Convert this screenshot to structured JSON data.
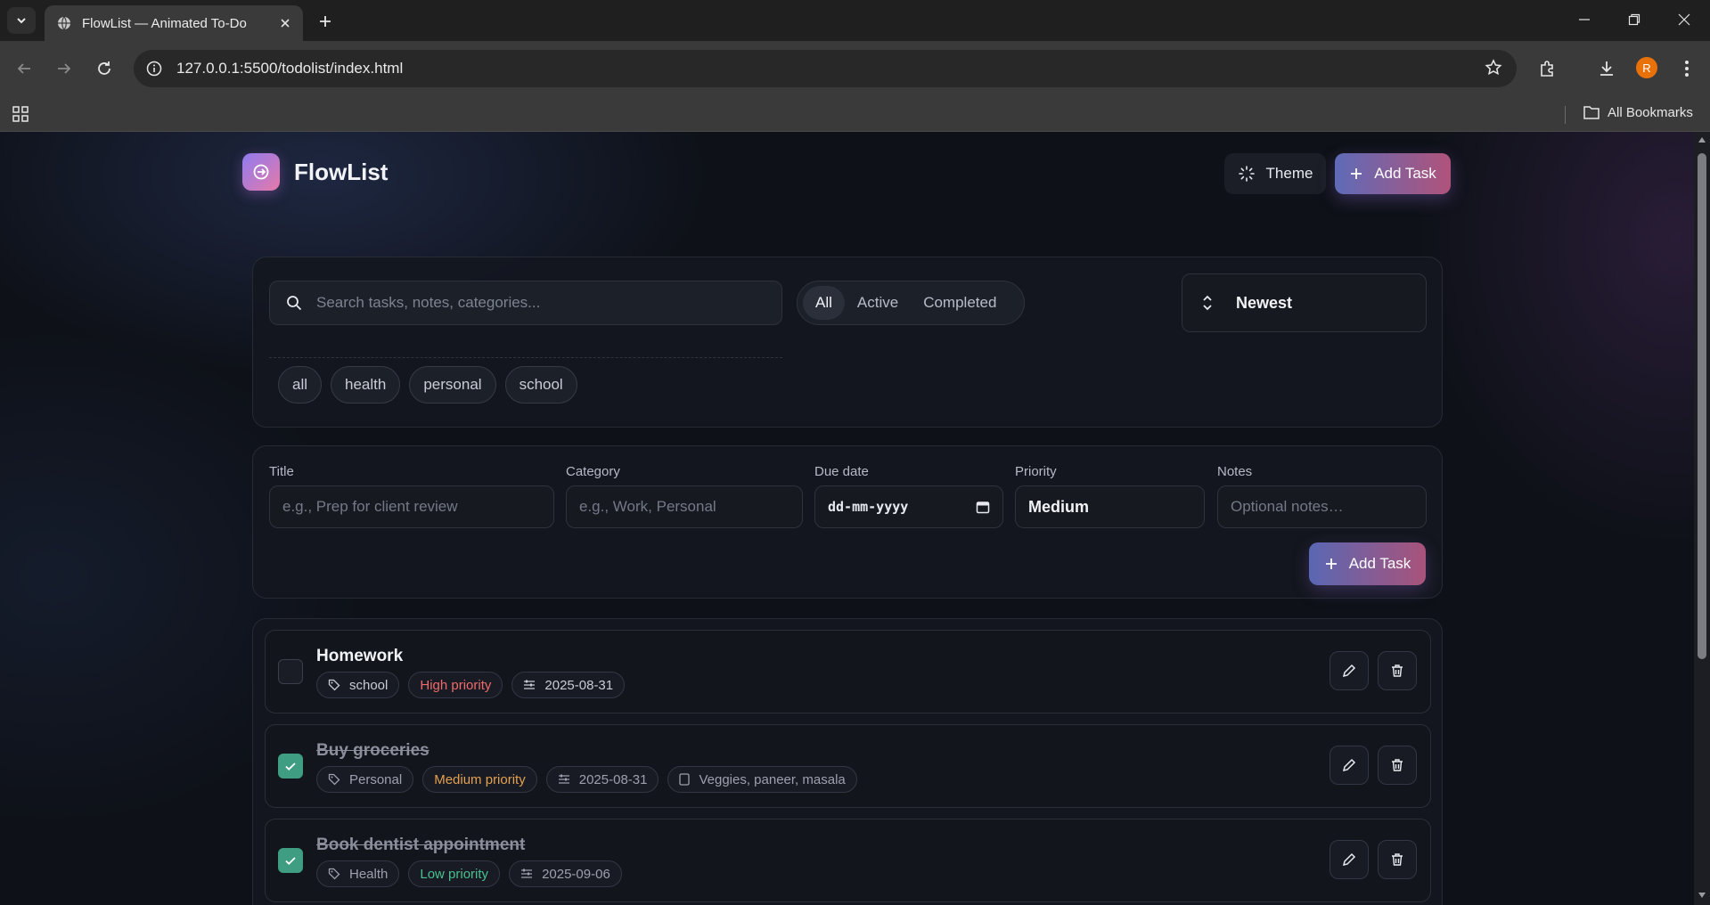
{
  "browser": {
    "tab_title": "FlowList — Animated To-Do",
    "url": "127.0.0.1:5500/todolist/index.html",
    "bookmarks_label": "All Bookmarks",
    "profile_initial": "R"
  },
  "header": {
    "brand": "FlowList",
    "theme_label": "Theme",
    "add_label": "Add Task"
  },
  "filters": {
    "search_placeholder": "Search tasks, notes, categories...",
    "status_tabs": [
      "All",
      "Active",
      "Completed"
    ],
    "active_tab": "All",
    "sort_value": "Newest",
    "category_chips": [
      "all",
      "health",
      "personal",
      "school"
    ]
  },
  "form": {
    "title_label": "Title",
    "title_placeholder": "e.g., Prep for client review",
    "category_label": "Category",
    "category_placeholder": "e.g., Work, Personal",
    "due_label": "Due date",
    "due_placeholder": "dd-mm-yyyy",
    "priority_label": "Priority",
    "priority_value": "Medium",
    "notes_label": "Notes",
    "notes_placeholder": "Optional notes…",
    "submit_label": "Add Task"
  },
  "tasks": [
    {
      "title": "Homework",
      "done": false,
      "category": "school",
      "priority": "High priority",
      "priority_level": "high",
      "due": "2025-08-31",
      "notes": ""
    },
    {
      "title": "Buy groceries",
      "done": true,
      "category": "Personal",
      "priority": "Medium priority",
      "priority_level": "medium",
      "due": "2025-08-31",
      "notes": "Veggies, paneer, masala"
    },
    {
      "title": "Book dentist appointment",
      "done": true,
      "category": "Health",
      "priority": "Low priority",
      "priority_level": "low",
      "due": "2025-09-06",
      "notes": ""
    }
  ],
  "colors": {
    "accent_start": "#5f6bb8",
    "accent_end": "#b0537a",
    "high": "#ef6b6b",
    "medium": "#e4a14f",
    "low": "#49c08f",
    "check_done": "#3f9e82"
  }
}
